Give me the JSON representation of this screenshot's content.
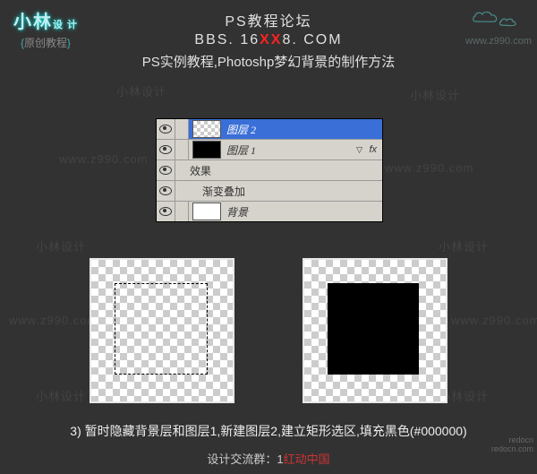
{
  "logo": {
    "name": "小林",
    "design": "设 计",
    "bracket_left": "{",
    "bracket_text": "原创教程",
    "bracket_right": "}"
  },
  "corner_url": "www.z990.com",
  "header": {
    "line1": "PS教程论坛",
    "line2_pre": "BBS. 16",
    "line2_xx": "XX",
    "line2_post": "8. COM",
    "line3": "PS实例教程,Photoshp梦幻背景的制作方法"
  },
  "watermarks": [
    "小林设计",
    "www.z990.com"
  ],
  "layers": {
    "rows": [
      {
        "label": "图层 2",
        "thumb": "checker",
        "selected": true,
        "eye": true
      },
      {
        "label": "图层 1",
        "thumb": "black",
        "fx": "fx",
        "eye": true
      },
      {
        "label": "效果",
        "effect": true,
        "eye": true
      },
      {
        "label": "渐变叠加",
        "subeffect": true,
        "eye": true
      },
      {
        "label": "背景",
        "thumb": "white",
        "eye": true
      }
    ]
  },
  "step_text": "3) 暂时隐藏背景层和图层1,新建图层2,建立矩形选区,填充黑色(#000000)",
  "footer": {
    "pre": "设计交流群：1",
    "red": "红动中国"
  },
  "redo_badge": {
    "l1": "redocn",
    "l2": "redocn.com"
  }
}
